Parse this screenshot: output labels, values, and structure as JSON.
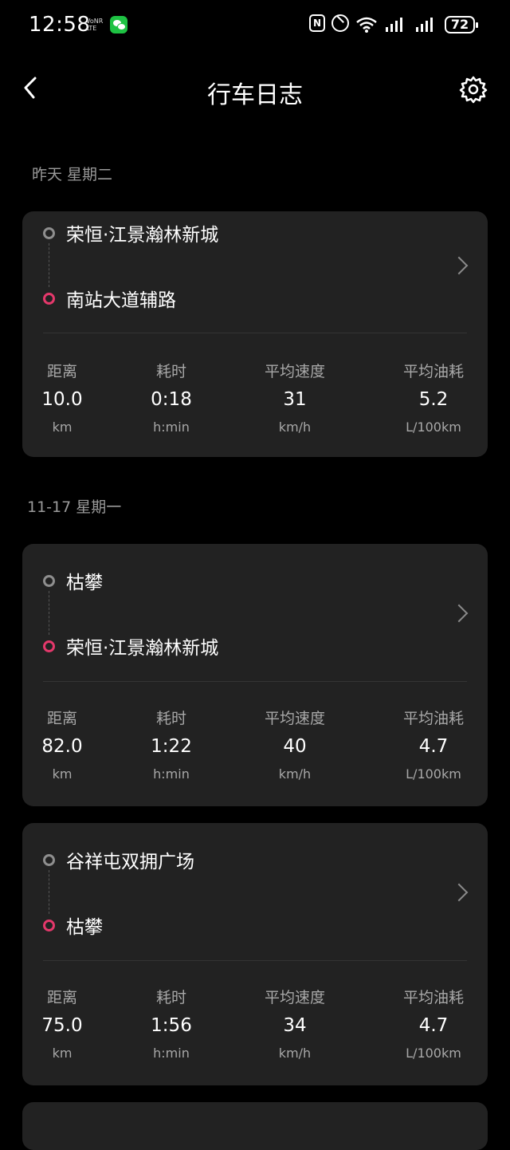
{
  "status_bar": {
    "time": "12:58",
    "carrier_top": "VoNR",
    "carrier_bottom": "LTE",
    "battery": "72"
  },
  "header": {
    "title": "行车日志"
  },
  "sections": [
    {
      "date": "昨天  星期二"
    },
    {
      "date": "11-17 星期一"
    }
  ],
  "stat_labels": {
    "distance": "距离",
    "duration": "耗时",
    "avg_speed": "平均速度",
    "avg_fuel": "平均油耗"
  },
  "stat_units": {
    "distance": "km",
    "duration": "h:min",
    "avg_speed": "km/h",
    "avg_fuel": "L/100km"
  },
  "trips": [
    {
      "start": "荣恒·江景瀚林新城",
      "end": "南站大道辅路",
      "distance": "10.0",
      "duration": "0:18",
      "avg_speed": "31",
      "avg_fuel": "5.2"
    },
    {
      "start": "枯攀",
      "end": "荣恒·江景瀚林新城",
      "distance": "82.0",
      "duration": "1:22",
      "avg_speed": "40",
      "avg_fuel": "4.7"
    },
    {
      "start": "谷祥屯双拥广场",
      "end": "枯攀",
      "distance": "75.0",
      "duration": "1:56",
      "avg_speed": "34",
      "avg_fuel": "4.7"
    }
  ],
  "colors": {
    "background": "#000000",
    "card": "#222222",
    "start_dot": "#8e8e8e",
    "end_dot": "#e4386b"
  }
}
